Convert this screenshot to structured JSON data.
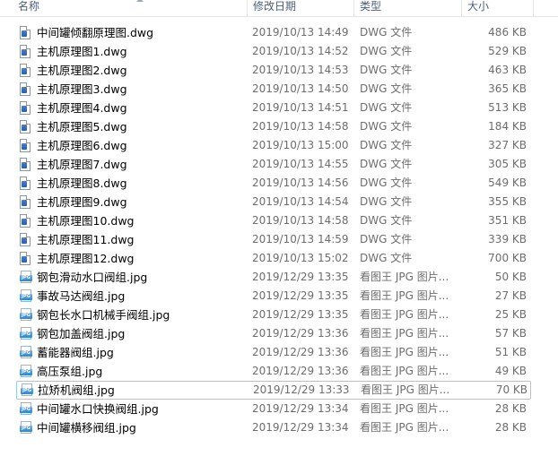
{
  "columns": {
    "name": "名称",
    "date": "修改日期",
    "type": "类型",
    "size": "大小"
  },
  "icons": {
    "dwg": "dwg-file-icon",
    "jpg": "jpg-file-icon",
    "jpg_badge": "JPG"
  },
  "files": [
    {
      "name": "中间罐倾翻原理图.dwg",
      "date": "2019/10/13 14:49",
      "type": "DWG 文件",
      "size": "486 KB",
      "kind": "dwg"
    },
    {
      "name": "主机原理图1.dwg",
      "date": "2019/10/13 14:52",
      "type": "DWG 文件",
      "size": "529 KB",
      "kind": "dwg"
    },
    {
      "name": "主机原理图2.dwg",
      "date": "2019/10/13 14:53",
      "type": "DWG 文件",
      "size": "463 KB",
      "kind": "dwg"
    },
    {
      "name": "主机原理图3.dwg",
      "date": "2019/10/13 14:50",
      "type": "DWG 文件",
      "size": "365 KB",
      "kind": "dwg"
    },
    {
      "name": "主机原理图4.dwg",
      "date": "2019/10/13 14:51",
      "type": "DWG 文件",
      "size": "513 KB",
      "kind": "dwg"
    },
    {
      "name": "主机原理图5.dwg",
      "date": "2019/10/13 14:58",
      "type": "DWG 文件",
      "size": "184 KB",
      "kind": "dwg"
    },
    {
      "name": "主机原理图6.dwg",
      "date": "2019/10/13 15:00",
      "type": "DWG 文件",
      "size": "327 KB",
      "kind": "dwg"
    },
    {
      "name": "主机原理图7.dwg",
      "date": "2019/10/13 14:55",
      "type": "DWG 文件",
      "size": "305 KB",
      "kind": "dwg"
    },
    {
      "name": "主机原理图8.dwg",
      "date": "2019/10/13 14:56",
      "type": "DWG 文件",
      "size": "549 KB",
      "kind": "dwg"
    },
    {
      "name": "主机原理图9.dwg",
      "date": "2019/10/13 14:54",
      "type": "DWG 文件",
      "size": "355 KB",
      "kind": "dwg"
    },
    {
      "name": "主机原理图10.dwg",
      "date": "2019/10/13 14:58",
      "type": "DWG 文件",
      "size": "351 KB",
      "kind": "dwg"
    },
    {
      "name": "主机原理图11.dwg",
      "date": "2019/10/13 14:59",
      "type": "DWG 文件",
      "size": "339 KB",
      "kind": "dwg"
    },
    {
      "name": "主机原理图12.dwg",
      "date": "2019/10/13 15:02",
      "type": "DWG 文件",
      "size": "700 KB",
      "kind": "dwg"
    },
    {
      "name": "钢包滑动水口阀组.jpg",
      "date": "2019/12/29 13:35",
      "type": "看图王 JPG 图片...",
      "size": "50 KB",
      "kind": "jpg"
    },
    {
      "name": "事故马达阀组.jpg",
      "date": "2019/12/29 13:35",
      "type": "看图王 JPG 图片...",
      "size": "27 KB",
      "kind": "jpg"
    },
    {
      "name": "钢包长水口机械手阀组.jpg",
      "date": "2019/12/29 13:35",
      "type": "看图王 JPG 图片...",
      "size": "25 KB",
      "kind": "jpg"
    },
    {
      "name": "钢包加盖阀组.jpg",
      "date": "2019/12/29 13:36",
      "type": "看图王 JPG 图片...",
      "size": "57 KB",
      "kind": "jpg"
    },
    {
      "name": "蓄能器阀组.jpg",
      "date": "2019/12/29 13:36",
      "type": "看图王 JPG 图片...",
      "size": "51 KB",
      "kind": "jpg"
    },
    {
      "name": "高压泵组.jpg",
      "date": "2019/12/29 13:36",
      "type": "看图王 JPG 图片...",
      "size": "49 KB",
      "kind": "jpg"
    },
    {
      "name": "拉矫机阀组.jpg",
      "date": "2019/12/29 13:33",
      "type": "看图王 JPG 图片...",
      "size": "70 KB",
      "kind": "jpg",
      "focused": true
    },
    {
      "name": "中间罐水口快换阀组.jpg",
      "date": "2019/12/29 13:34",
      "type": "看图王 JPG 图片...",
      "size": "28 KB",
      "kind": "jpg"
    },
    {
      "name": "中间罐横移阀组.jpg",
      "date": "2019/12/29 13:34",
      "type": "看图王 JPG 图片...",
      "size": "28 KB",
      "kind": "jpg"
    }
  ]
}
